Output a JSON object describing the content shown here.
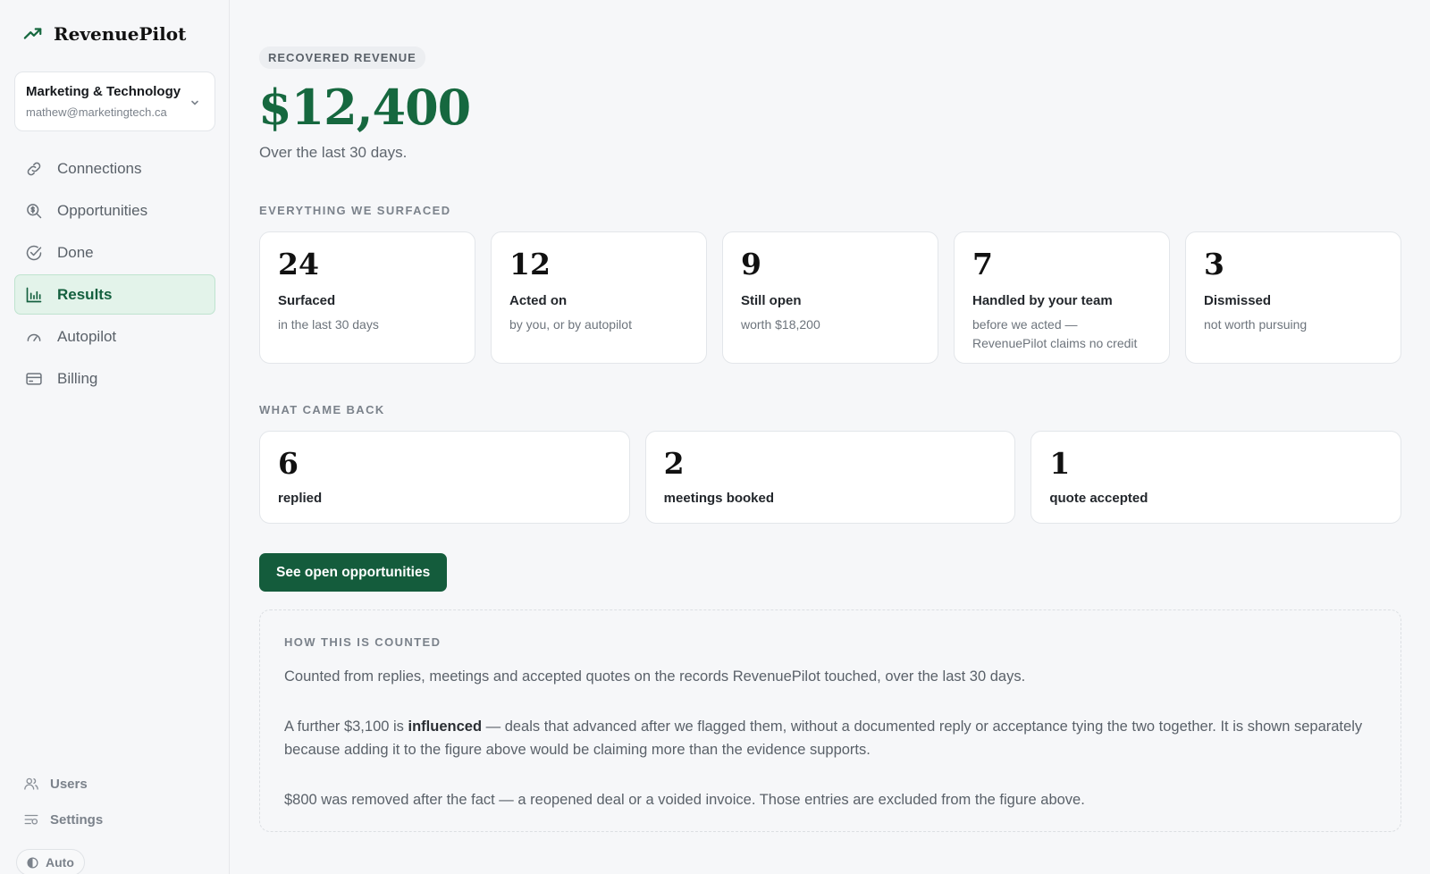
{
  "app": {
    "name": "RevenuePilot",
    "logo_icon": "trending-up-icon"
  },
  "workspace": {
    "name": "Marketing & Technology",
    "email": "mathew@marketingtech.ca"
  },
  "nav": {
    "items": [
      {
        "label": "Connections",
        "icon": "link-icon"
      },
      {
        "label": "Opportunities",
        "icon": "search-dollar-icon"
      },
      {
        "label": "Done",
        "icon": "check-circle-icon"
      },
      {
        "label": "Results",
        "icon": "bar-chart-icon",
        "active": true
      },
      {
        "label": "Autopilot",
        "icon": "gauge-icon"
      },
      {
        "label": "Billing",
        "icon": "credit-card-icon"
      }
    ],
    "bottom": [
      {
        "label": "Users",
        "icon": "users-icon"
      },
      {
        "label": "Settings",
        "icon": "sliders-icon"
      }
    ],
    "theme_toggle": "Auto"
  },
  "hero": {
    "pill": "RECOVERED REVENUE",
    "value": "$12,400",
    "subtitle": "Over the last 30 days."
  },
  "surfaced": {
    "label": "EVERYTHING WE SURFACED",
    "cards": [
      {
        "num": "24",
        "label": "Surfaced",
        "desc": "in the last 30 days"
      },
      {
        "num": "12",
        "label": "Acted on",
        "desc": "by you, or by autopilot"
      },
      {
        "num": "9",
        "label": "Still open",
        "desc": "worth $18,200"
      },
      {
        "num": "7",
        "label": "Handled by your team",
        "desc": "before we acted — RevenuePilot claims no credit"
      },
      {
        "num": "3",
        "label": "Dismissed",
        "desc": "not worth pursuing"
      }
    ]
  },
  "came_back": {
    "label": "WHAT CAME BACK",
    "cards": [
      {
        "num": "6",
        "label": "replied"
      },
      {
        "num": "2",
        "label": "meetings booked"
      },
      {
        "num": "1",
        "label": "quote accepted"
      }
    ]
  },
  "cta": {
    "label": "See open opportunities"
  },
  "explain": {
    "title": "HOW THIS IS COUNTED",
    "p1": "Counted from replies, meetings and accepted quotes on the records RevenuePilot touched, over the last 30 days.",
    "p2_pre": "A further $3,100 is ",
    "p2_bold": "influenced",
    "p2_post": " — deals that advanced after we flagged them, without a documented reply or acceptance tying the two together. It is shown separately because adding it to the figure above would be claiming more than the evidence supports.",
    "p3": "$800 was removed after the fact — a reopened deal or a voided invoice. Those entries are excluded from the figure above."
  },
  "colors": {
    "accent": "#16683f",
    "button": "#145c3c",
    "active_bg": "#e3f3ea"
  }
}
